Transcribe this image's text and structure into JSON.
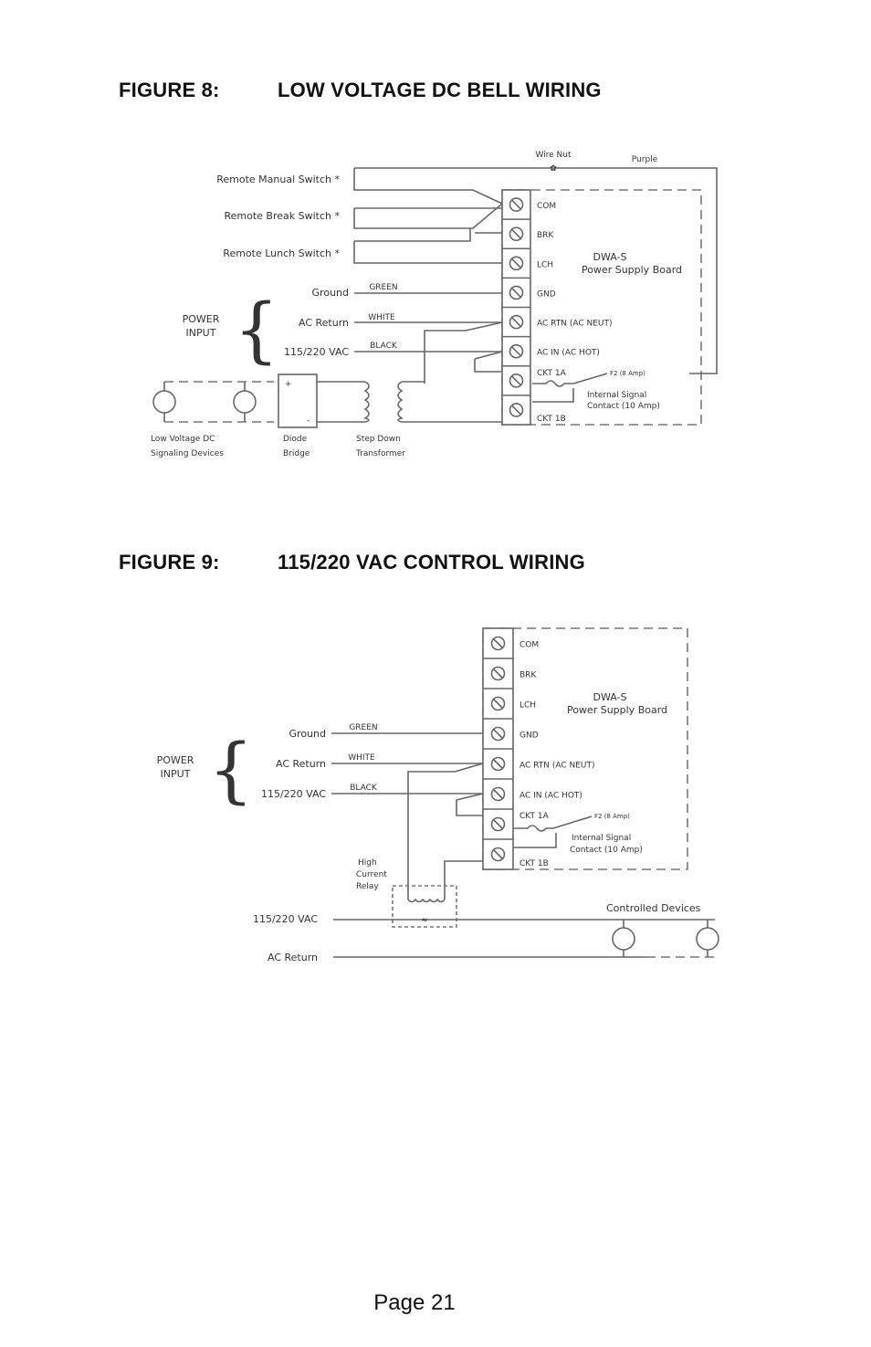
{
  "figures": [
    {
      "number": "FIGURE 8:",
      "title": "LOW VOLTAGE DC BELL WIRING",
      "board": {
        "name": "DWA-S",
        "subtitle": "Power Supply Board"
      },
      "terminals": [
        "COM",
        "BRK",
        "LCH",
        "GND",
        "AC RTN (AC NEUT)",
        "AC IN (AC HOT)",
        "CKT 1A",
        "CKT 1B"
      ],
      "switches": [
        "Remote Manual Switch *",
        "Remote Break Switch *",
        "Remote Lunch Switch *"
      ],
      "wire_nut": "Wire Nut",
      "purple": "Purple",
      "power_input": {
        "label_line1": "POWER",
        "label_line2": "INPUT",
        "rows": [
          {
            "name": "Ground",
            "color": "GREEN"
          },
          {
            "name": "AC Return",
            "color": "WHITE"
          },
          {
            "name": "115/220 VAC",
            "color": "BLACK"
          }
        ]
      },
      "fuse": "F2 (8 Amp)",
      "contact_line1": "Internal Signal",
      "contact_line2": "Contact (10 Amp)",
      "devices_line1": "Low Voltage DC",
      "devices_line2": "Signaling Devices",
      "bridge_line1": "Diode",
      "bridge_line2": "Bridge",
      "transformer_line1": "Step Down",
      "transformer_line2": "Transformer",
      "plus": "+",
      "minus": "-"
    },
    {
      "number": "FIGURE 9:",
      "title": "115/220 VAC CONTROL WIRING",
      "board": {
        "name": "DWA-S",
        "subtitle": "Power Supply Board"
      },
      "terminals": [
        "COM",
        "BRK",
        "LCH",
        "GND",
        "AC RTN (AC NEUT)",
        "AC IN (AC HOT)",
        "CKT 1A",
        "CKT 1B"
      ],
      "power_input": {
        "label_line1": "POWER",
        "label_line2": "INPUT",
        "rows": [
          {
            "name": "Ground",
            "color": "GREEN"
          },
          {
            "name": "AC Return",
            "color": "WHITE"
          },
          {
            "name": "115/220 VAC",
            "color": "BLACK"
          }
        ]
      },
      "fuse": "F2 (8 Amp)",
      "contact_line1": "Internal Signal",
      "contact_line2": "Contact (10 Amp)",
      "relay_line1": "High",
      "relay_line2": "Current",
      "relay_line3": "Relay",
      "line_vac": "115/220 VAC",
      "line_return": "AC Return",
      "controlled_devices": "Controlled Devices"
    }
  ],
  "footer": {
    "page": "Page 21"
  }
}
